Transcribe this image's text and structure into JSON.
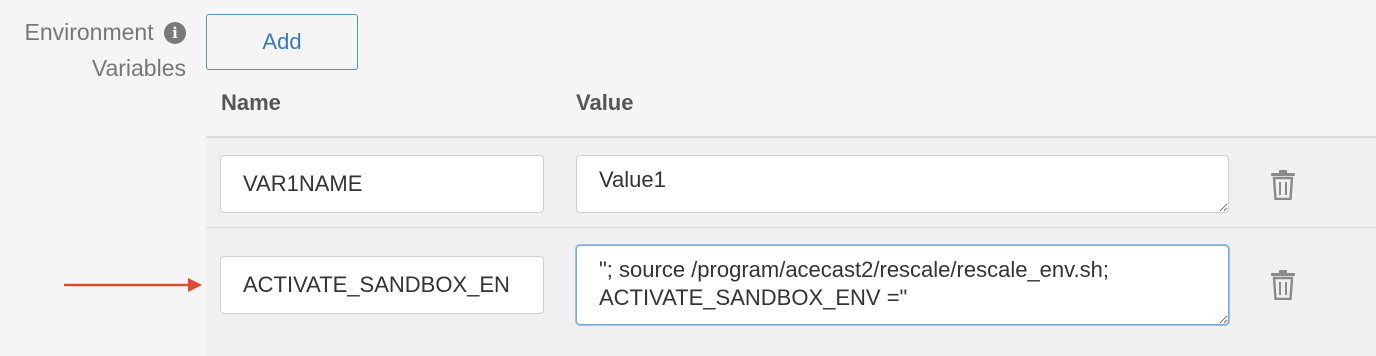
{
  "field": {
    "label_line1": "Environment",
    "label_line2": "Variables",
    "info_glyph": "i",
    "info_icon": "info-icon"
  },
  "add_button": {
    "label": "Add"
  },
  "table": {
    "columns": [
      "Name",
      "Value"
    ],
    "rows": [
      {
        "name": "VAR1NAME",
        "value": "Value1",
        "delete_icon": "trash-icon"
      },
      {
        "name": "ACTIVATE_SANDBOX_EN",
        "value": "\"; source /program/acecast2/rescale/rescale_env.sh;\nACTIVATE_SANDBOX_ENV =\"",
        "delete_icon": "trash-icon"
      }
    ]
  },
  "colors": {
    "accent": "#3a7ab0",
    "arrow": "#e04a2f",
    "focus_border": "#7aa9d8"
  }
}
